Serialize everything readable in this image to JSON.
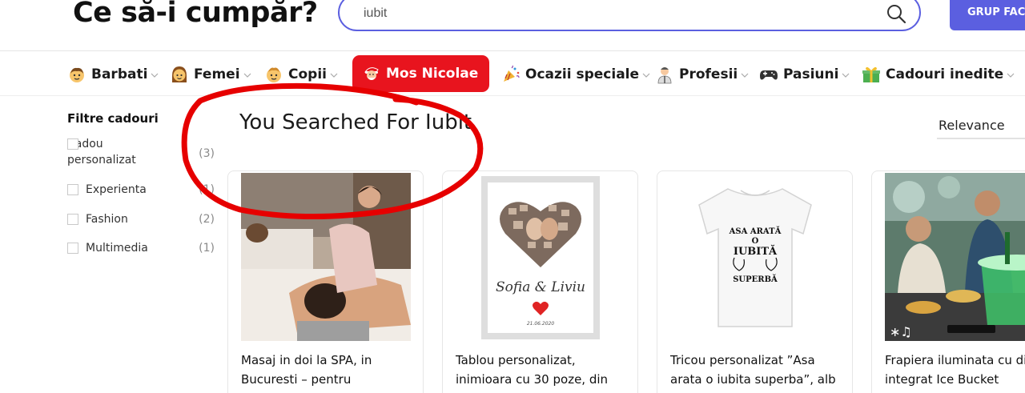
{
  "header": {
    "logo": "Ce să-i cumpăr?",
    "search_value": "iubit",
    "group_button": "GRUP FACE"
  },
  "nav": [
    {
      "label": "Barbati",
      "icon": "boy-face-icon"
    },
    {
      "label": "Femei",
      "icon": "woman-face-icon"
    },
    {
      "label": "Copii",
      "icon": "child-face-icon"
    },
    {
      "label": "Mos Nicolae",
      "icon": "santa-face-icon",
      "highlight": true
    },
    {
      "label": "Ocazii speciale",
      "icon": "party-popper-icon"
    },
    {
      "label": "Profesii",
      "icon": "worker-icon"
    },
    {
      "label": "Pasiuni",
      "icon": "gamepad-icon"
    },
    {
      "label": "Cadouri inedite",
      "icon": "gift-icon"
    }
  ],
  "filters": {
    "title": "Filtre cadouri",
    "items": [
      {
        "label": "Cadou personalizat",
        "count": "(3)"
      },
      {
        "label": "Experienta",
        "count": "(1)"
      },
      {
        "label": "Fashion",
        "count": "(2)"
      },
      {
        "label": "Multimedia",
        "count": "(1)"
      }
    ]
  },
  "results": {
    "title": "You Searched For Iubit",
    "sort": "Relevance"
  },
  "products": [
    {
      "title": "Masaj in doi la SPA, in Bucuresti – pentru"
    },
    {
      "title": "Tablou personalizat, inimioara cu 30 poze, din",
      "names": "Sofia & Liviu",
      "date": "21.06.2020"
    },
    {
      "title": "Tricou personalizat ”Asa arata o iubita superba”, alb",
      "shirt_text": [
        "ASA ARATĂ",
        "O",
        "IUBITĂ",
        "SUPERBĂ"
      ]
    },
    {
      "title": "Frapiera iluminata cu difuzor integrat Ice Bucket"
    }
  ],
  "colors": {
    "accent": "#5b5fe0",
    "highlight": "#e8141e",
    "annotation": "#e60000"
  }
}
